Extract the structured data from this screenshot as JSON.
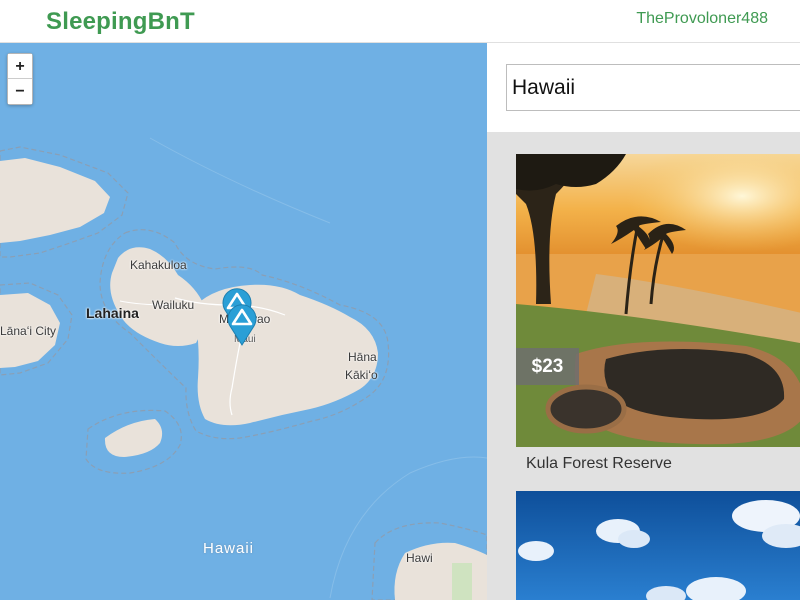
{
  "header": {
    "brand": "SleepingBnT",
    "username": "TheProvoloner488"
  },
  "map": {
    "zoom_in": "+",
    "zoom_out": "−",
    "labels": {
      "kahakuloa": "Kahakuloa",
      "lahaina": "Lahaina",
      "wailuku": "Wailuku",
      "makawao": "Makawao",
      "maui": "Maui",
      "hana": "Hāna",
      "kakio": "Kākiʻo",
      "lanai_city": "Lānaʻi City",
      "hawaii": "Hawaii",
      "hawi": "Hawi"
    },
    "colors": {
      "water": "#6fb0e4",
      "land": "#e9e2da",
      "marker": "#2a9fd6"
    }
  },
  "search": {
    "value": "Hawaii"
  },
  "listings": [
    {
      "price": "$23",
      "title": "Kula Forest Reserve"
    },
    {
      "price": "",
      "title": ""
    }
  ]
}
